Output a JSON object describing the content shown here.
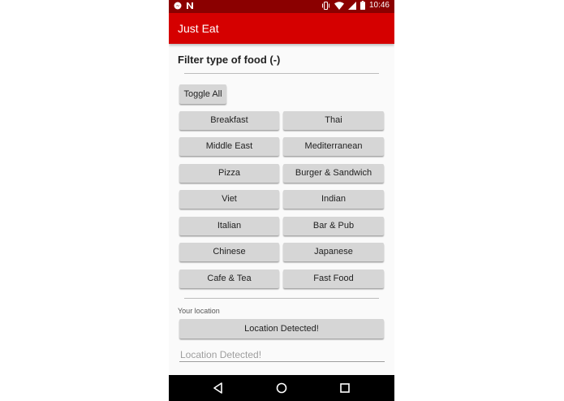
{
  "status_bar": {
    "time": "10:46",
    "left_icons": [
      "messenger-icon",
      "n-notification-icon"
    ],
    "right_icons": [
      "vibrate-icon",
      "wifi-icon",
      "signal-icon",
      "battery-icon"
    ]
  },
  "app_bar": {
    "title": "Just Eat"
  },
  "filter": {
    "title": "Filter type of food (-)",
    "toggle_all_label": "Toggle All",
    "food_types": [
      "Breakfast",
      "Thai",
      "Middle East",
      "Mediterranean",
      "Pizza",
      "Burger & Sandwich",
      "Viet",
      "Indian",
      "Italian",
      "Bar & Pub",
      "Chinese",
      "Japanese",
      "Cafe & Tea",
      "Fast Food"
    ]
  },
  "location": {
    "label": "Your location",
    "button_label": "Location Detected!",
    "input_value": "",
    "input_placeholder": "Location Detected!"
  },
  "nav_bar": {
    "icons": [
      "back-icon",
      "home-icon",
      "recents-icon"
    ]
  },
  "colors": {
    "status_bar": "#8b0000",
    "app_bar": "#d50000",
    "button_bg": "#d6d6d6",
    "background": "#fafafa"
  }
}
